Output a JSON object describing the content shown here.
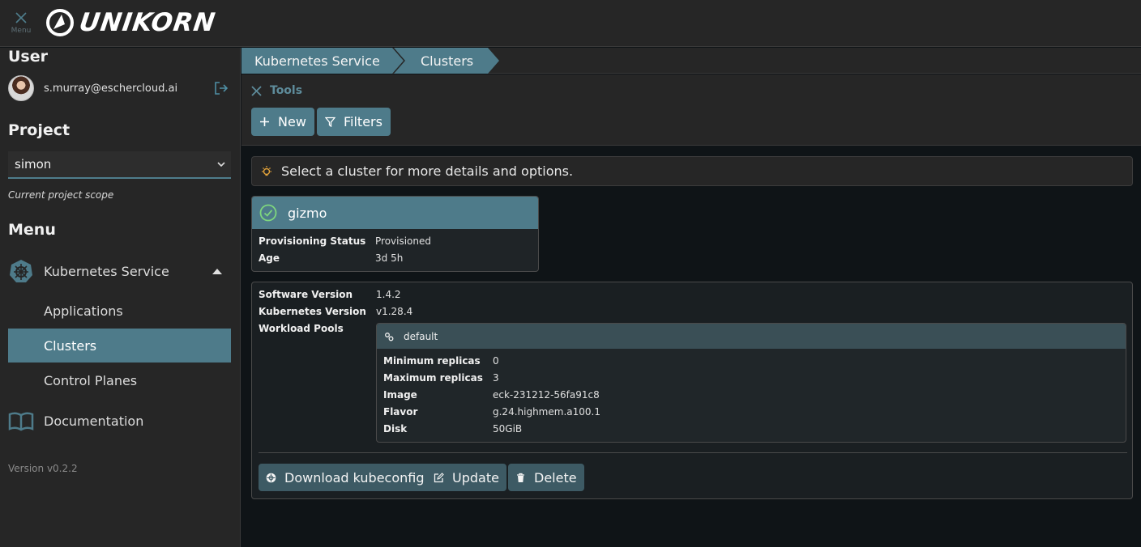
{
  "topbar": {
    "menu_label": "Menu",
    "logo_text": "UNIKORN"
  },
  "sidebar": {
    "user_heading": "User",
    "user_email": "s.murray@eschercloud.ai",
    "project_heading": "Project",
    "project_value": "simon",
    "project_scope_note": "Current project scope",
    "menu_heading": "Menu",
    "items": [
      {
        "label": "Kubernetes Service",
        "icon": "helm-wheel-icon",
        "expanded": true
      },
      {
        "label": "Applications"
      },
      {
        "label": "Clusters",
        "active": true
      },
      {
        "label": "Control Planes"
      },
      {
        "label": "Documentation",
        "icon": "book-icon"
      }
    ],
    "version": "Version v0.2.2"
  },
  "breadcrumb": [
    "Kubernetes Service",
    "Clusters"
  ],
  "tools": {
    "label": "Tools",
    "new_label": "New",
    "filters_label": "Filters"
  },
  "hint": "Select a cluster for more details and options.",
  "cluster": {
    "name": "gizmo",
    "status_icon": "check-circle-icon",
    "fields": [
      {
        "key": "Provisioning Status",
        "value": "Provisioned"
      },
      {
        "key": "Age",
        "value": "3d 5h"
      }
    ]
  },
  "details": {
    "software_version_label": "Software Version",
    "software_version": "1.4.2",
    "kubernetes_version_label": "Kubernetes Version",
    "kubernetes_version": "v1.28.4",
    "workload_pools_label": "Workload Pools",
    "pool": {
      "name": "default",
      "fields": [
        {
          "key": "Minimum replicas",
          "value": "0"
        },
        {
          "key": "Maximum replicas",
          "value": "3"
        },
        {
          "key": "Image",
          "value": "eck-231212-56fa91c8"
        },
        {
          "key": "Flavor",
          "value": "g.24.highmem.a100.1"
        },
        {
          "key": "Disk",
          "value": "50GiB"
        }
      ]
    },
    "actions": {
      "download": "Download kubeconfig",
      "update": "Update",
      "delete": "Delete"
    }
  },
  "colors": {
    "accent": "#4e7b8a",
    "background": "#0f1417",
    "panel": "#262626",
    "success": "#7ed67e",
    "hint_bulb": "#e3a33a"
  }
}
